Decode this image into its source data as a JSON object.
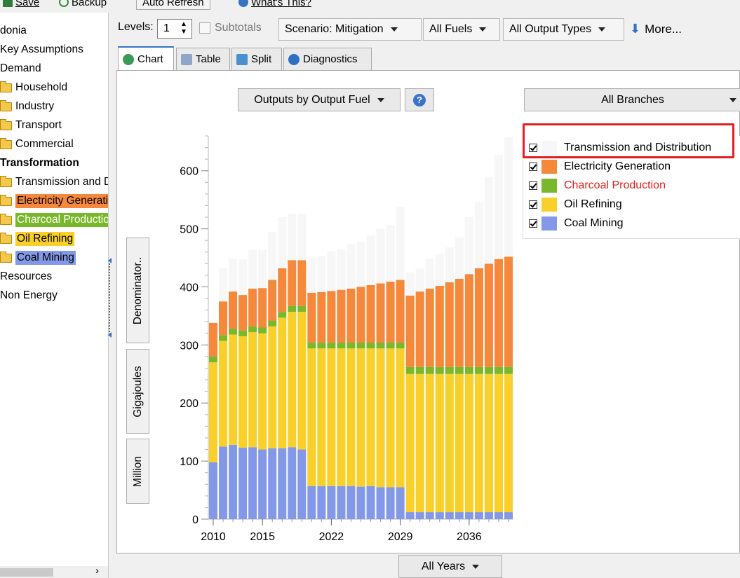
{
  "toolbar": {
    "save_label": "Save",
    "backup_label": "Backup",
    "auto_refresh_label": "Auto Refresh",
    "whats_this_label": "What's This?"
  },
  "tree": {
    "items": [
      {
        "label": "donia",
        "type": "plain"
      },
      {
        "label": "Key Assumptions",
        "type": "plain"
      },
      {
        "label": "Demand",
        "type": "plain"
      },
      {
        "label": "Household",
        "type": "folder"
      },
      {
        "label": "Industry",
        "type": "folder"
      },
      {
        "label": "Transport",
        "type": "folder"
      },
      {
        "label": "Commercial",
        "type": "folder"
      },
      {
        "label": "Transformation",
        "type": "bold"
      },
      {
        "label": "Transmission and Distribution",
        "type": "folder"
      },
      {
        "label": "Electricity Generation",
        "type": "folder",
        "bg": "#f5883a"
      },
      {
        "label": "Charcoal Production",
        "type": "folder",
        "bg": "#78b82a",
        "color": "#ffffff"
      },
      {
        "label": "Oil Refining",
        "type": "folder",
        "bg": "#f9cf2a"
      },
      {
        "label": "Coal Mining",
        "type": "folder",
        "bg": "#8399e7"
      },
      {
        "label": "Resources",
        "type": "plain"
      },
      {
        "label": "Non Energy",
        "type": "plain"
      }
    ]
  },
  "controls": {
    "levels_label": "Levels:",
    "levels_value": "1",
    "subtotals_label": "Subtotals",
    "scenario_label": "Scenario: Mitigation",
    "fuels_label": "All Fuels",
    "output_types_label": "All Output Types",
    "more_label": "More..."
  },
  "tabs": [
    {
      "label": "Chart",
      "active": true,
      "icon": "chart-icon"
    },
    {
      "label": "Table",
      "active": false,
      "icon": "table-icon"
    },
    {
      "label": "Split",
      "active": false,
      "icon": "split-icon"
    },
    {
      "label": "Diagnostics",
      "active": false,
      "icon": "diagnostics-icon"
    }
  ],
  "panel": {
    "outputs_dropdown": "Outputs by Output Fuel",
    "branches_dropdown": "All Branches",
    "years_dropdown": "All Years",
    "unit_buttons": [
      "Million",
      "Gigajoules",
      "Denominator.."
    ]
  },
  "chart_data": {
    "type": "bar",
    "stacked": true,
    "title": "",
    "xlabel": "",
    "ylabel": "",
    "ylim": [
      0,
      660
    ],
    "yticks": [
      0,
      100,
      200,
      300,
      400,
      500,
      600
    ],
    "xtick_labels": [
      "2010",
      "2015",
      "2022",
      "2029",
      "2036"
    ],
    "categories": [
      "2010",
      "2011",
      "2012",
      "2013",
      "2014",
      "2015",
      "2016",
      "2017",
      "2018",
      "2019",
      "2020",
      "2021",
      "2022",
      "2023",
      "2024",
      "2025",
      "2026",
      "2027",
      "2028",
      "2029",
      "2030",
      "2031",
      "2032",
      "2033",
      "2034",
      "2035",
      "2036",
      "2037",
      "2038",
      "2039",
      "2040"
    ],
    "series": [
      {
        "name": "Coal Mining",
        "color": "#8399e7",
        "values": [
          98,
          125,
          128,
          123,
          124,
          120,
          122,
          122,
          124,
          120,
          57,
          57,
          57,
          57,
          57,
          56,
          57,
          55,
          55,
          55,
          12,
          12,
          12,
          12,
          12,
          12,
          12,
          12,
          12,
          12,
          12
        ]
      },
      {
        "name": "Oil Refining",
        "color": "#f9cf2a",
        "values": [
          172,
          182,
          190,
          192,
          198,
          200,
          210,
          225,
          233,
          237,
          237,
          237,
          237,
          237,
          237,
          238,
          237,
          239,
          239,
          239,
          238,
          238,
          238,
          238,
          238,
          238,
          238,
          238,
          238,
          238,
          238
        ]
      },
      {
        "name": "Charcoal Production",
        "color": "#78b82a",
        "values": [
          10,
          10,
          10,
          10,
          10,
          10,
          10,
          10,
          10,
          10,
          10,
          10,
          10,
          10,
          10,
          10,
          10,
          10,
          10,
          10,
          12,
          12,
          12,
          12,
          12,
          12,
          12,
          12,
          12,
          12,
          12
        ]
      },
      {
        "name": "Electricity Generation",
        "color": "#f5883a",
        "values": [
          58,
          58,
          64,
          61,
          65,
          68,
          70,
          75,
          79,
          79,
          86,
          87,
          89,
          91,
          93,
          96,
          99,
          102,
          105,
          108,
          123,
          130,
          135,
          140,
          146,
          152,
          160,
          170,
          178,
          186,
          190
        ]
      },
      {
        "name": "Transmission and Distribution",
        "color": "#f7f7f7",
        "values": [
          0,
          57,
          57,
          61,
          67,
          66,
          83,
          88,
          80,
          80,
          60,
          62,
          68,
          70,
          77,
          77,
          85,
          94,
          98,
          126,
          40,
          40,
          52,
          55,
          60,
          72,
          98,
          114,
          150,
          180,
          206
        ]
      }
    ],
    "legend": {
      "placement": "right",
      "entries": [
        {
          "name": "Transmission and Distribution",
          "checked": true
        },
        {
          "name": "Electricity Generation",
          "checked": true
        },
        {
          "name": "Charcoal Production",
          "checked": true,
          "color": "#e02020"
        },
        {
          "name": "Oil Refining",
          "checked": true
        },
        {
          "name": "Coal Mining",
          "checked": true
        }
      ]
    }
  }
}
